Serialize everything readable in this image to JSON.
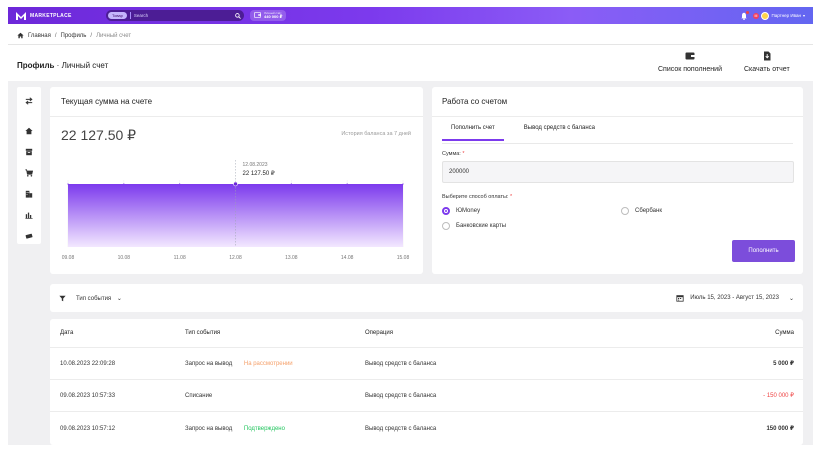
{
  "header": {
    "logo_text": "MARKETPLACE",
    "search_category": "Товар",
    "search_placeholder": "Search",
    "balance_label": "Личный счёт",
    "balance_value": "440 000 ₽",
    "user_badge": "М",
    "user_name": "Партнер Иван"
  },
  "breadcrumb": {
    "home": "Главная",
    "separator": "/",
    "profile": "Профиль",
    "current": "Личный счет"
  },
  "page": {
    "title_bold": "Профиль",
    "title_rest": " · Личный счет",
    "action_topups": "Список пополнений",
    "action_download": "Скачать отчет"
  },
  "balance_card": {
    "title": "Текущая сумма на счете",
    "amount": "22 127.50 ₽",
    "history_label": "История баланса за 7 дней"
  },
  "chart_data": {
    "type": "area",
    "x": [
      "09.08",
      "10.08",
      "11.08",
      "12.08",
      "13.08",
      "14.08",
      "15.08"
    ],
    "values": [
      22127.5,
      22127.5,
      22127.5,
      22127.5,
      22127.5,
      22127.5,
      22127.5
    ],
    "tooltip": {
      "date": "12.08.2023",
      "value": "22 127.50 ₽"
    },
    "fill_colors": [
      "#7c3aed",
      "#f3e8ff"
    ],
    "grid": true
  },
  "account_card": {
    "title": "Работа со счетом",
    "tab_topup": "Пополнить счет",
    "tab_withdraw": "Вывод средств с баланса",
    "amount_label": "Сумма:",
    "required_mark": "*",
    "amount_value": "200000",
    "payment_label": "Выберите способ оплаты:",
    "payment_options": [
      "ЮMoney",
      "Сбербанк",
      "Банковские карты"
    ],
    "selected_payment": "ЮMoney",
    "submit_label": "Пополнить"
  },
  "filter": {
    "event_type_label": "Тип события",
    "date_range": "Июль 15, 2023  -  Август 15, 2023"
  },
  "table": {
    "columns": [
      "Дата",
      "Тип события",
      "Операция",
      "Сумма"
    ],
    "rows": [
      {
        "date": "10.08.2023 22:09:28",
        "type": "Запрос на вывод",
        "status": "На рассмотрении",
        "operation": "Вывод средств с баланса",
        "sum": "5 000 ₽"
      },
      {
        "date": "09.08.2023 10:57:33",
        "type": "Списание",
        "status": "",
        "operation": "Вывод средств с баланса",
        "sum": "- 150 000 ₽"
      },
      {
        "date": "09.08.2023 10:57:12",
        "type": "Запрос на вывод",
        "status": "Подтверждено",
        "operation": "Вывод средств с баланса",
        "sum": "150 000 ₽"
      }
    ]
  },
  "colors": {
    "accent": "#7c3aed",
    "status_review": "#f5a06a",
    "status_ok": "#22c55e",
    "negative": "#ef4444"
  }
}
